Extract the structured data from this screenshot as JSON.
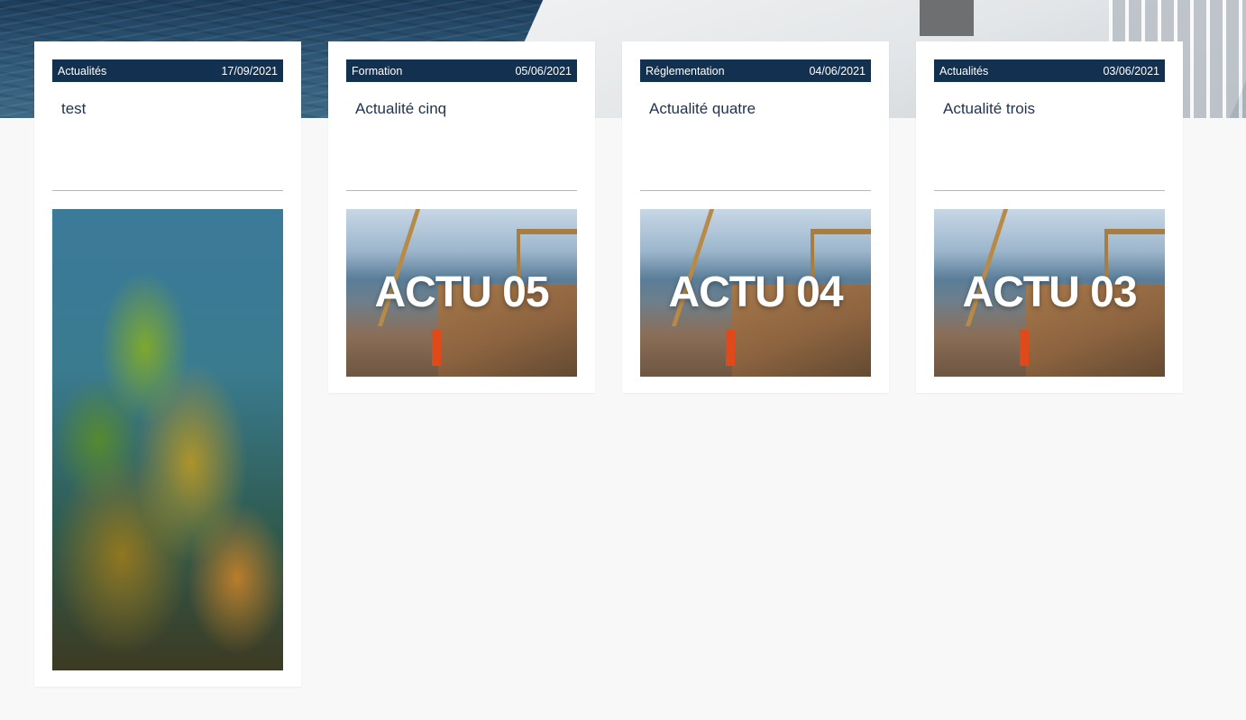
{
  "cards": [
    {
      "category": "Actualités",
      "date": "17/09/2021",
      "title": "test",
      "image": "kelp-underwater",
      "image_text": ""
    },
    {
      "category": "Formation",
      "date": "05/06/2021",
      "title": "Actualité cinq",
      "image": "fishing-boat-deck",
      "image_text": "ACTU 05"
    },
    {
      "category": "Réglementation",
      "date": "04/06/2021",
      "title": "Actualité quatre",
      "image": "fishing-boat-deck",
      "image_text": "ACTU 04"
    },
    {
      "category": "Actualités",
      "date": "03/06/2021",
      "title": "Actualité trois",
      "image": "fishing-boat-deck",
      "image_text": "ACTU 03"
    }
  ],
  "colors": {
    "header_bg": "#12304f",
    "title_text": "#1d3350",
    "page_bg": "#f8f8f8"
  }
}
